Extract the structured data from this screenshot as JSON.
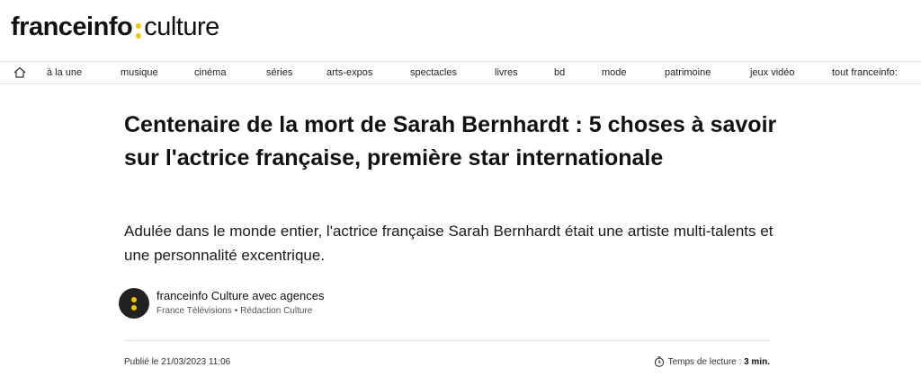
{
  "logo": {
    "brand": "franceinfo",
    "section": "culture",
    "accent_color": "#f5c400"
  },
  "nav": {
    "home_icon": "home-icon",
    "items": [
      "à la une",
      "musique",
      "cinéma",
      "séries",
      "arts-expos",
      "spectacles",
      "livres",
      "bd",
      "mode",
      "patrimoine",
      "jeux vidéo",
      "tout franceinfo:"
    ]
  },
  "article": {
    "title": "Centenaire de la mort de Sarah Bernhardt : 5 choses à savoir sur l'actrice française, première star internationale",
    "lede": "Adulée dans le monde entier, l'actrice française Sarah Bernhardt était une artiste multi-talents et une personnalité excentrique.",
    "author": {
      "name": "franceinfo Culture avec agences",
      "org": "France Télévisions",
      "dept": "Rédaction Culture",
      "separator": "•"
    },
    "published": "Publié le 21/03/2023 11:06",
    "reading_label": "Temps de lecture :",
    "reading_time": "3 min."
  }
}
